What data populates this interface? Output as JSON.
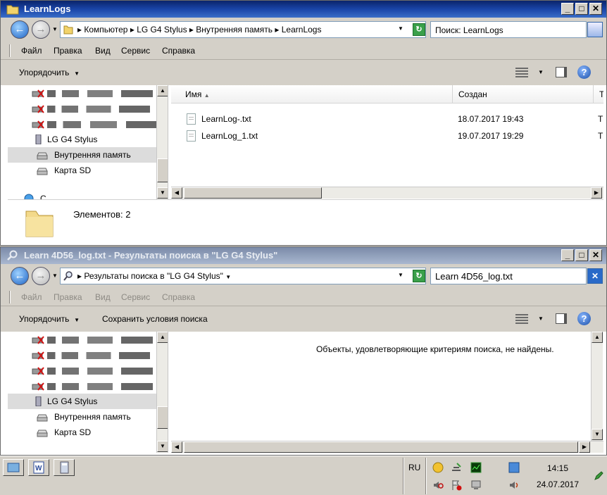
{
  "colors": {
    "active_title": "#0a246a",
    "inactive_title": "#a9b7cf",
    "chrome": "#d4d0c8"
  },
  "window1": {
    "title": "LearnLogs",
    "controls": {
      "minimize": "_",
      "maximize": "□",
      "close": "✕"
    },
    "breadcrumbs": [
      "Компьютер",
      "LG G4 Stylus",
      "Внутренняя память",
      "LearnLogs"
    ],
    "breadcrumb_separator": "▸",
    "search": {
      "value": "Поиск: LearnLogs"
    },
    "menu": [
      "Файл",
      "Правка",
      "Вид",
      "Сервис",
      "Справка"
    ],
    "toolbar": {
      "organize": "Упорядочить"
    },
    "nav": {
      "device": "LG G4 Stylus",
      "internal": "Внутренняя память",
      "sd": "Карта SD",
      "next_letter": "С"
    },
    "columns": {
      "name": "Имя",
      "created": "Создан",
      "type": "Т"
    },
    "files": [
      {
        "name": "LearnLog-.txt",
        "created": "18.07.2017 19:43",
        "type": "Т"
      },
      {
        "name": "LearnLog_1.txt",
        "created": "19.07.2017 19:29",
        "type": "Т"
      }
    ],
    "details": {
      "count": "Элементов: 2"
    }
  },
  "window2": {
    "title": "Learn 4D56_log.txt - Результаты поиска в \"LG G4 Stylus\"",
    "controls": {
      "minimize": "_",
      "maximize": "□",
      "close": "✕"
    },
    "breadcrumb": "Результаты поиска в \"LG G4 Stylus\"",
    "search": {
      "value": "Learn 4D56_log.txt"
    },
    "menu": [
      "Файл",
      "Правка",
      "Вид",
      "Сервис",
      "Справка"
    ],
    "toolbar": {
      "organize": "Упорядочить",
      "save_search": "Сохранить условия поиска"
    },
    "nav": {
      "device": "LG G4 Stylus",
      "internal": "Внутренняя память",
      "sd": "Карта SD"
    },
    "empty_message": "Объекты, удовлетворяющие критериям поиска, не найдены."
  },
  "taskbar": {
    "language": "RU",
    "time": "14:15",
    "date": "24.07.2017"
  }
}
